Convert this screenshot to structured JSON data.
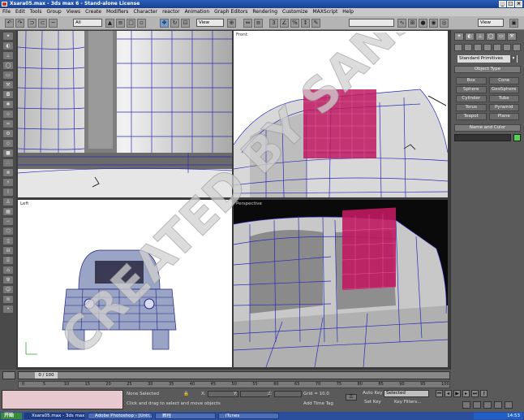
{
  "window": {
    "title": "Xsara05.max - 3ds max 6 - Stand-alone License",
    "controls": [
      "_",
      "□",
      "×"
    ]
  },
  "menu": [
    "File",
    "Edit",
    "Tools",
    "Group",
    "Views",
    "Create",
    "Modifiers",
    "Character",
    "reactor",
    "Animation",
    "Graph Editors",
    "Rendering",
    "Customize",
    "MAXScript",
    "Help"
  ],
  "toolbar": {
    "selection_filter": "All",
    "ref_coord": "View",
    "named_selection": "",
    "view_right": "View"
  },
  "viewports": {
    "front_label": "Front",
    "left_label": "Left",
    "perspective_label": "Perspective"
  },
  "command_panel": {
    "category": "Standard Primitives",
    "rollout_object_type": "Object Type",
    "buttons": [
      "Box",
      "Cone",
      "Sphere",
      "GeoSphere",
      "Cylinder",
      "Tube",
      "Torus",
      "Pyramid",
      "Teapot",
      "Plane"
    ],
    "rollout_name_color": "Name and Color",
    "object_color": "#55d155"
  },
  "timeline": {
    "frame": "0 / 100",
    "ticks": [
      "0",
      "5",
      "10",
      "15",
      "20",
      "25",
      "30",
      "35",
      "40",
      "45",
      "50",
      "55",
      "60",
      "65",
      "70",
      "75",
      "80",
      "85",
      "90",
      "95",
      "100"
    ]
  },
  "status": {
    "selection": "None Selected",
    "prompt": "Click and drag to select and move objects",
    "x_label": "X:",
    "y_label": "Y:",
    "z_label": "Z:",
    "grid": "Grid = 10.0",
    "add_time_tag": "Add Time Tag",
    "auto_key": "Auto Key",
    "auto_key_value": "Selected",
    "set_key": "Set Key",
    "key_filters": "Key Filters..."
  },
  "taskbar": {
    "start": "开始",
    "tasks": [
      "Xsara05.max - 3ds max ...",
      "Adobe Photoshop - [Unti...",
      "教程",
      "iTunes"
    ],
    "clock": "14:53"
  },
  "watermark": "CREATED BY SANSHI"
}
